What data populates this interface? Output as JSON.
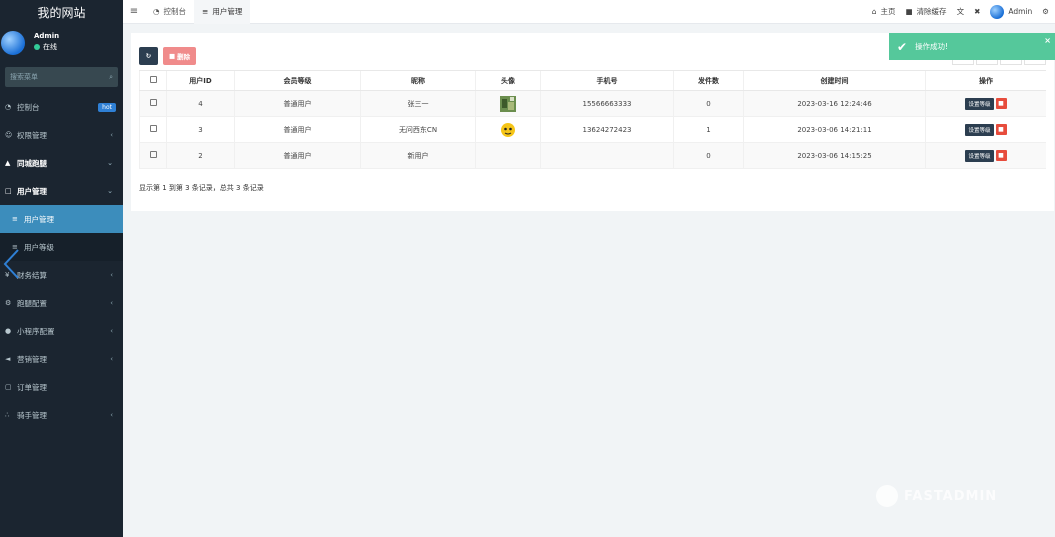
{
  "sidebar": {
    "brand": "我的网站",
    "user_name": "Admin",
    "user_status": "在线",
    "search_placeholder": "搜索菜单",
    "items": [
      {
        "label": "控制台",
        "badge": "hot"
      },
      {
        "label": "权限管理"
      },
      {
        "label": "同城跑腿"
      },
      {
        "label": "用户管理"
      },
      {
        "label": "用户管理"
      },
      {
        "label": "用户等级"
      },
      {
        "label": "财务结算"
      },
      {
        "label": "跑腿配置"
      },
      {
        "label": "小程序配置"
      },
      {
        "label": "营销管理"
      },
      {
        "label": "订单管理"
      },
      {
        "label": "骑手管理"
      }
    ]
  },
  "topbar": {
    "tabs": [
      "控制台",
      "用户管理"
    ],
    "home": "主页",
    "clear_cache": "清除缓存",
    "admin": "Admin"
  },
  "toolbar": {
    "delete_label": "删除"
  },
  "table": {
    "headers": [
      "用户ID",
      "会员等级",
      "昵称",
      "头像",
      "手机号",
      "发件数",
      "创建时间",
      "操作"
    ],
    "rows": [
      {
        "id": "4",
        "level": "普通用户",
        "nick": "张三一",
        "phone": "15566663333",
        "count": "0",
        "time": "2023-03-16 12:24:46"
      },
      {
        "id": "3",
        "level": "普通用户",
        "nick": "无问西东CN",
        "phone": "13624272423",
        "count": "1",
        "time": "2023-03-06 14:21:11"
      },
      {
        "id": "2",
        "level": "普通用户",
        "nick": "新用户",
        "phone": "",
        "count": "0",
        "time": "2023-03-06 14:15:25"
      }
    ],
    "set_level_label": "设置等级"
  },
  "pager_text": "显示第 1 到第 3 条记录，总共 3 条记录",
  "toast": "操作成功!",
  "watermark": "FASTADMIN"
}
